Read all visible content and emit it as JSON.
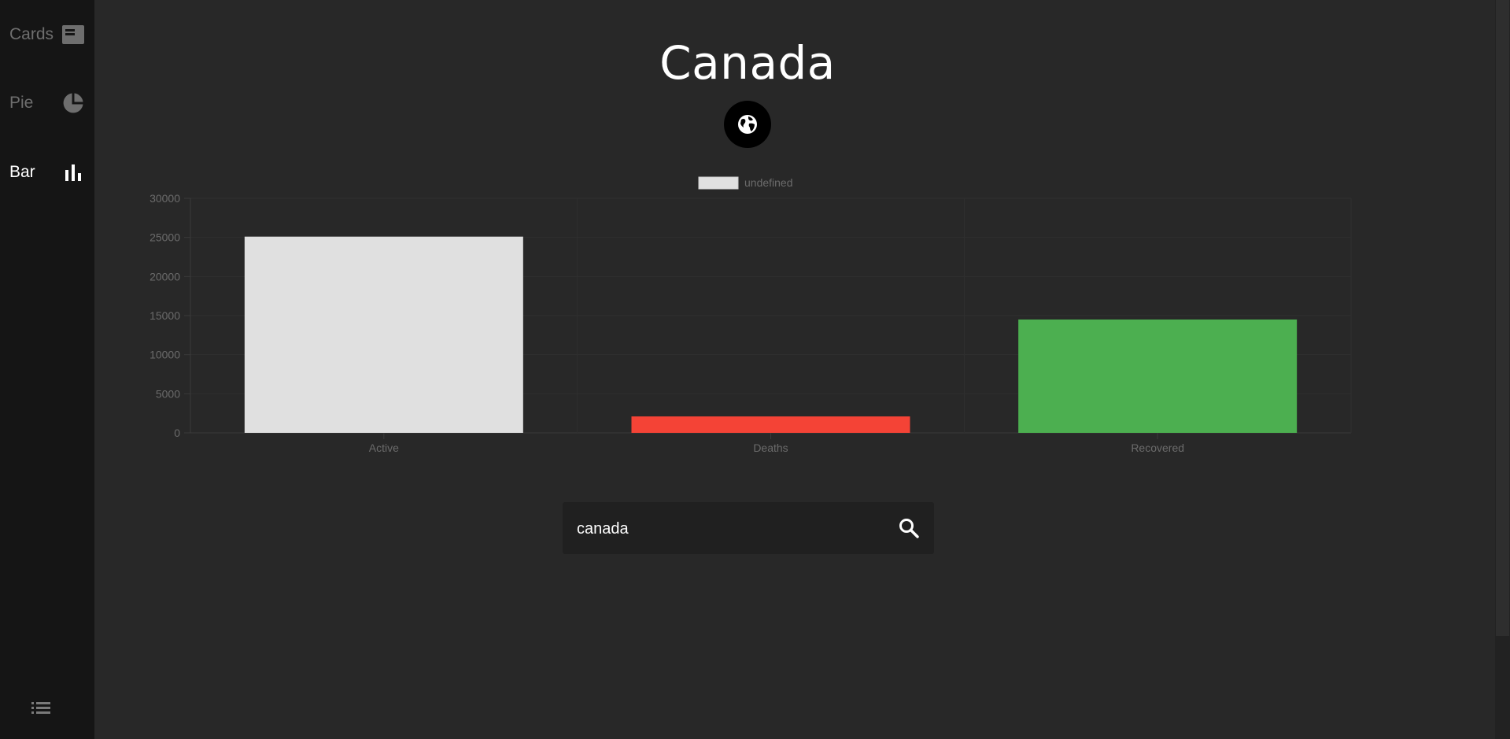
{
  "sidebar": {
    "items": [
      {
        "label": "Cards",
        "icon": "cards-icon"
      },
      {
        "label": "Pie",
        "icon": "pie-chart-icon"
      },
      {
        "label": "Bar",
        "icon": "bar-chart-icon",
        "active": true
      }
    ],
    "menu_icon": "list-icon"
  },
  "header": {
    "title": "Canada",
    "globe_icon": "globe-icon"
  },
  "search": {
    "value": "canada",
    "icon": "search-icon"
  },
  "colors": {
    "background": "#282828",
    "sidebar": "#151515",
    "active": "#e0e0e0",
    "deaths": "#f44336",
    "recovered": "#4caf50",
    "axis_text": "#6b6b6b"
  },
  "chart_data": {
    "type": "bar",
    "categories": [
      "Active",
      "Deaths",
      "Recovered"
    ],
    "values": [
      25100,
      2100,
      14500
    ],
    "bar_colors": [
      "#e0e0e0",
      "#f44336",
      "#4caf50"
    ],
    "legend": "undefined",
    "legend_position": "top-center",
    "ylim": [
      0,
      30000
    ],
    "yticks": [
      0,
      5000,
      10000,
      15000,
      20000,
      25000,
      30000
    ],
    "grid": true
  }
}
